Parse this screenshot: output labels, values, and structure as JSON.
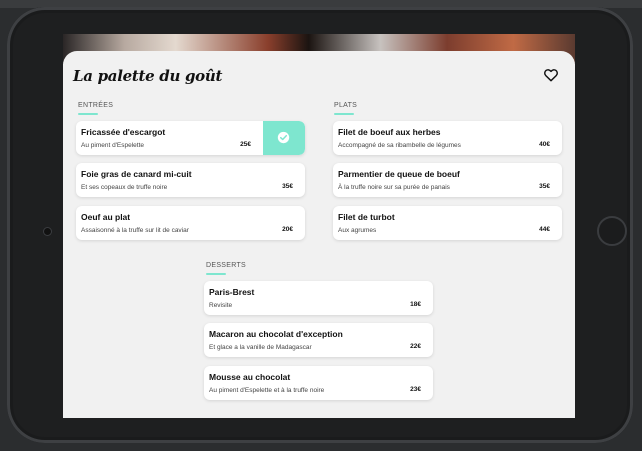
{
  "restaurant": {
    "title": "La palette du goût"
  },
  "sections": {
    "entrees": {
      "title": "ENTRÉES",
      "items": [
        {
          "name": "Fricassée d'escargot",
          "desc": "Au piment d'Espelette",
          "price": "25€",
          "selected": true
        },
        {
          "name": "Foie gras de canard mi-cuit",
          "desc": "Et ses copeaux de truffe noire",
          "price": "35€"
        },
        {
          "name": "Oeuf au plat",
          "desc": "Assaisonné à la truffe sur lit de caviar",
          "price": "20€"
        }
      ]
    },
    "plats": {
      "title": "PLATS",
      "items": [
        {
          "name": "Filet de boeuf aux herbes",
          "desc": "Accompagné de sa ribambelle de légumes",
          "price": "40€"
        },
        {
          "name": "Parmentier de queue de boeuf",
          "desc": "À la truffe noire sur sa purée de panais",
          "price": "35€"
        },
        {
          "name": "Filet de turbot",
          "desc": "Aux agrumes",
          "price": "44€"
        }
      ]
    },
    "desserts": {
      "title": "DESSERTS",
      "items": [
        {
          "name": "Paris-Brest",
          "desc": "Revisite",
          "price": "18€"
        },
        {
          "name": "Macaron au chocolat d'exception",
          "desc": "Et glace a la vanille de Madagascar",
          "price": "22€"
        },
        {
          "name": "Mousse au chocolat",
          "desc": "Au piment d'Espelette et à la truffe noire",
          "price": "23€"
        }
      ]
    }
  },
  "colors": {
    "accent": "#7ee6cf",
    "card": "#ffffff",
    "background": "#f1f1f1"
  },
  "icons": {
    "favorite": "heart-icon",
    "selected": "check-icon"
  }
}
